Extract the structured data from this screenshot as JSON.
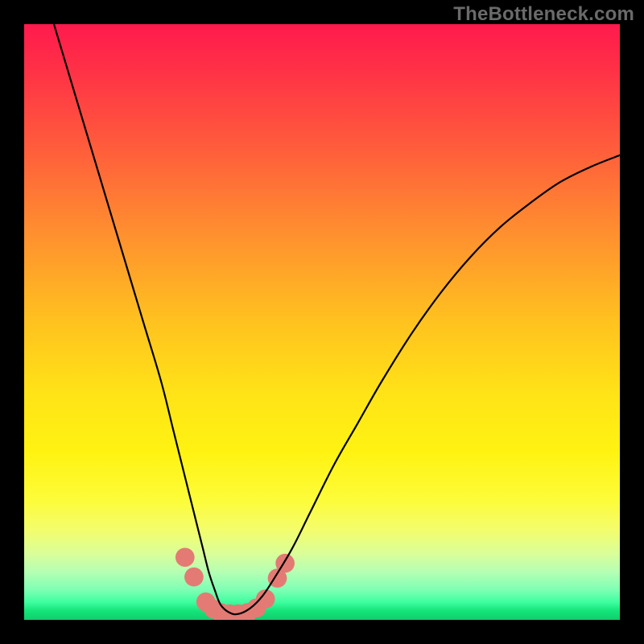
{
  "watermark": {
    "text": "TheBottleneck.com"
  },
  "chart_data": {
    "type": "line",
    "title": "",
    "xlabel": "",
    "ylabel": "",
    "xlim": [
      0,
      100
    ],
    "ylim": [
      0,
      100
    ],
    "grid": false,
    "legend": false,
    "background": {
      "type": "vertical-gradient",
      "stops": [
        {
          "pos": 0,
          "color": "#ff1a4d"
        },
        {
          "pos": 0.35,
          "color": "#ff8f2f"
        },
        {
          "pos": 0.62,
          "color": "#ffe317"
        },
        {
          "pos": 0.85,
          "color": "#f3fd6d"
        },
        {
          "pos": 1.0,
          "color": "#0fce6d"
        }
      ]
    },
    "series": [
      {
        "name": "curve",
        "color": "#000000",
        "x": [
          5,
          8,
          11,
          14,
          17,
          20,
          23,
          25,
          27,
          28.5,
          30,
          31,
          32,
          33,
          34.5,
          36,
          38,
          40,
          42,
          45,
          48,
          52,
          56,
          60,
          65,
          70,
          75,
          80,
          85,
          90,
          95,
          100
        ],
        "y": [
          100,
          90,
          80,
          70,
          60,
          50,
          40,
          32,
          24,
          18,
          12,
          8,
          5,
          2.5,
          1.2,
          1,
          2,
          4,
          7,
          12,
          18,
          26,
          33,
          40,
          48,
          55,
          61,
          66,
          70,
          73.5,
          76,
          78
        ]
      }
    ],
    "markers": [
      {
        "name": "left-marker-upper",
        "x": 27.0,
        "y": 10.5,
        "color": "#e47a74",
        "r": 1.6
      },
      {
        "name": "left-marker-mid",
        "x": 28.5,
        "y": 7.2,
        "color": "#e47a74",
        "r": 1.6
      },
      {
        "name": "left-marker-low1",
        "x": 30.5,
        "y": 3.0,
        "color": "#e47a74",
        "r": 1.6
      },
      {
        "name": "left-marker-low2",
        "x": 31.8,
        "y": 1.8,
        "color": "#e47a74",
        "r": 1.6
      },
      {
        "name": "bottom-marker-1",
        "x": 33.0,
        "y": 1.2,
        "color": "#e47a74",
        "r": 1.6
      },
      {
        "name": "bottom-marker-2",
        "x": 34.5,
        "y": 1.0,
        "color": "#e47a74",
        "r": 1.6
      },
      {
        "name": "bottom-marker-3",
        "x": 36.0,
        "y": 1.0,
        "color": "#e47a74",
        "r": 1.6
      },
      {
        "name": "bottom-marker-4",
        "x": 37.5,
        "y": 1.2,
        "color": "#e47a74",
        "r": 1.6
      },
      {
        "name": "right-marker-low1",
        "x": 39.0,
        "y": 2.0,
        "color": "#e47a74",
        "r": 1.6
      },
      {
        "name": "right-marker-low2",
        "x": 40.5,
        "y": 3.5,
        "color": "#e47a74",
        "r": 1.6
      },
      {
        "name": "right-marker-mid",
        "x": 42.5,
        "y": 7.0,
        "color": "#e47a74",
        "r": 1.6
      },
      {
        "name": "right-marker-upper",
        "x": 43.8,
        "y": 9.5,
        "color": "#e47a74",
        "r": 1.6
      }
    ]
  }
}
